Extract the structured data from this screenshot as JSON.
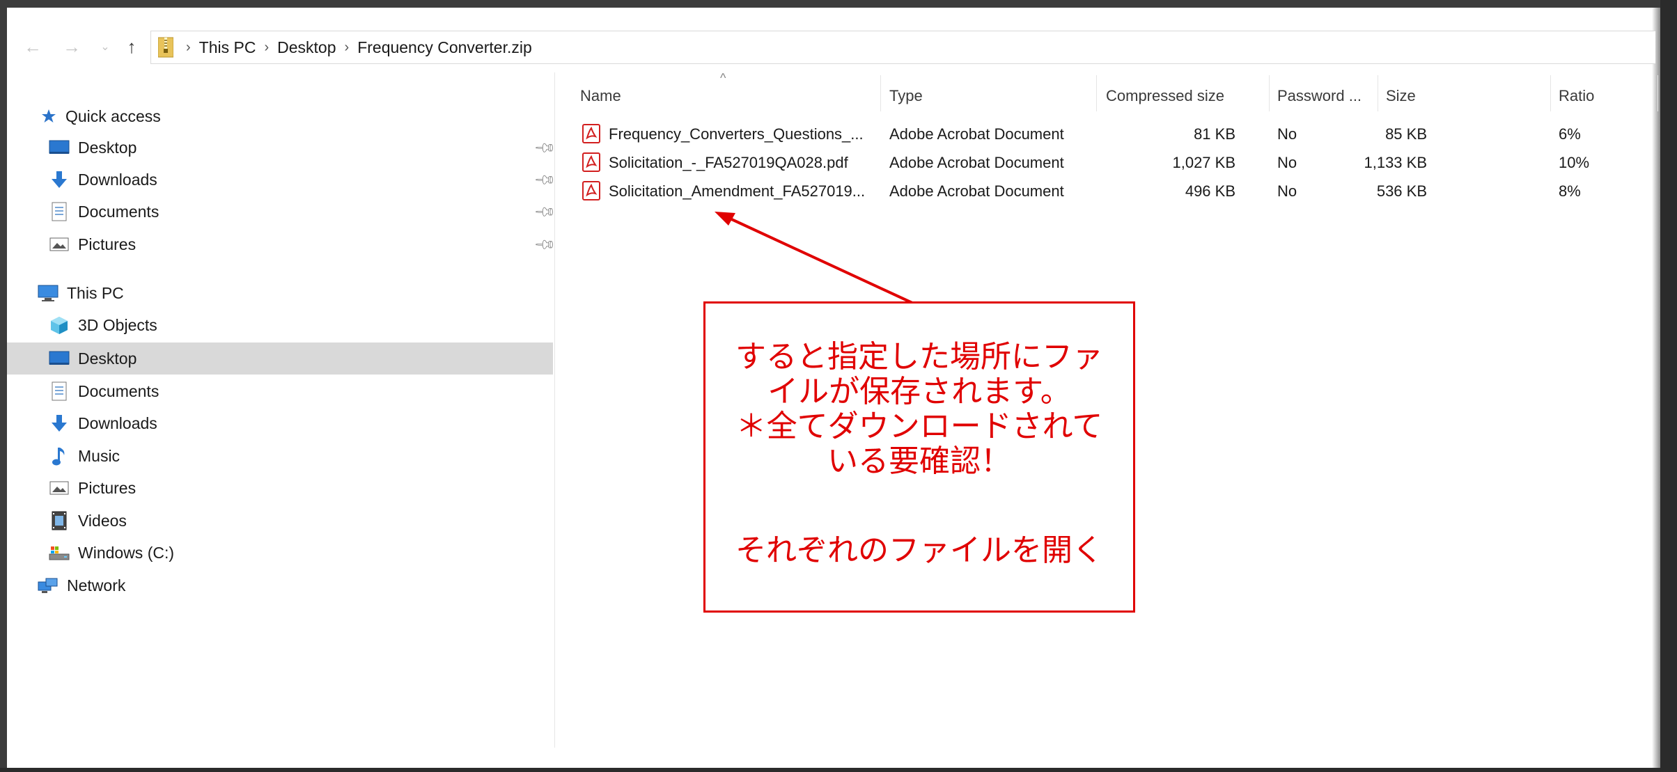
{
  "breadcrumb": {
    "items": [
      "This PC",
      "Desktop",
      "Frequency Converter.zip"
    ]
  },
  "sidebar": {
    "quick_access": "Quick access",
    "quick_items": [
      "Desktop",
      "Downloads",
      "Documents",
      "Pictures"
    ],
    "this_pc": "This PC",
    "pc_items": [
      "3D Objects",
      "Desktop",
      "Documents",
      "Downloads",
      "Music",
      "Pictures",
      "Videos",
      "Windows (C:)"
    ],
    "network": "Network",
    "selected": "Desktop"
  },
  "columns": {
    "name": "Name",
    "type": "Type",
    "compressed": "Compressed size",
    "password": "Password ...",
    "size": "Size",
    "ratio": "Ratio"
  },
  "files": [
    {
      "name": "Frequency_Converters_Questions_...",
      "type": "Adobe Acrobat Document",
      "compressed": "81 KB",
      "password": "No",
      "size": "85 KB",
      "ratio": "6%"
    },
    {
      "name": "Solicitation_-_FA527019QA028.pdf",
      "type": "Adobe Acrobat Document",
      "compressed": "1,027 KB",
      "password": "No",
      "size": "1,133 KB",
      "ratio": "10%"
    },
    {
      "name": "Solicitation_Amendment_FA527019...",
      "type": "Adobe Acrobat Document",
      "compressed": "496 KB",
      "password": "No",
      "size": "536 KB",
      "ratio": "8%"
    }
  ],
  "annotation": {
    "lines": [
      "すると指定した場所にファ",
      "イルが保存されます。",
      "＊全てダウンロードされて",
      "いる要確認！"
    ],
    "last_line": "それぞれのファイルを開く",
    "color": "#e00000"
  },
  "icons": {
    "back": "back-arrow-icon",
    "forward": "forward-arrow-icon",
    "recent": "chevron-down-icon",
    "up": "up-arrow-icon",
    "zip": "zip-folder-icon",
    "pdf": "pdf-icon",
    "pin": "pin-icon"
  }
}
